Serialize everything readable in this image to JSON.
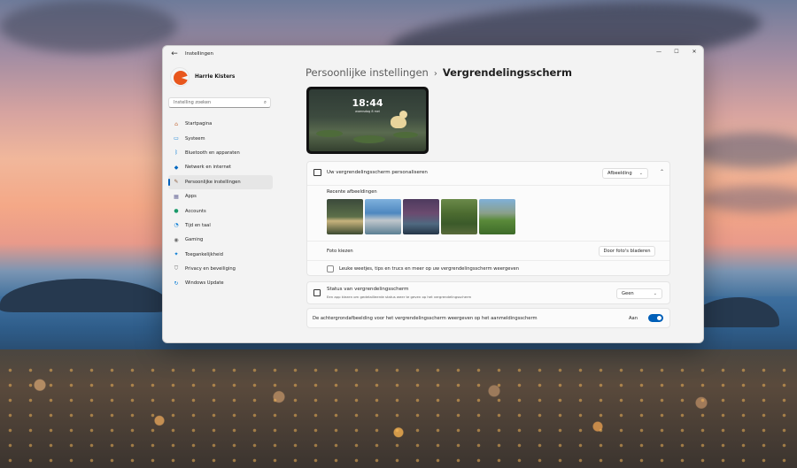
{
  "window": {
    "app_title": "Instellingen",
    "back_glyph": "←",
    "minimize_glyph": "—",
    "maximize_glyph": "☐",
    "close_glyph": "✕"
  },
  "profile": {
    "name": "Harrie Kisters"
  },
  "search": {
    "placeholder": "Instelling zoeken",
    "icon_glyph": "⌕"
  },
  "sidebar": {
    "items": [
      {
        "label": "Startpagina",
        "icon": "home-icon",
        "glyph": "⌂",
        "color": "#c46a3a",
        "active": false
      },
      {
        "label": "Systeem",
        "icon": "system-icon",
        "glyph": "▭",
        "color": "#0078d4",
        "active": false
      },
      {
        "label": "Bluetooth en apparaten",
        "icon": "bluetooth-icon",
        "glyph": "ᛒ",
        "color": "#0078d4",
        "active": false
      },
      {
        "label": "Netwerk en internet",
        "icon": "network-icon",
        "glyph": "◆",
        "color": "#0067c0",
        "active": false
      },
      {
        "label": "Persoonlijke instellingen",
        "icon": "personalization-icon",
        "glyph": "✎",
        "color": "#8a5a3a",
        "active": true
      },
      {
        "label": "Apps",
        "icon": "apps-icon",
        "glyph": "▦",
        "color": "#6b6b9a",
        "active": false
      },
      {
        "label": "Accounts",
        "icon": "accounts-icon",
        "glyph": "●",
        "color": "#1a9a6a",
        "active": false
      },
      {
        "label": "Tijd en taal",
        "icon": "time-language-icon",
        "glyph": "◔",
        "color": "#0078d4",
        "active": false
      },
      {
        "label": "Gaming",
        "icon": "gaming-icon",
        "glyph": "◉",
        "color": "#6b6b6b",
        "active": false
      },
      {
        "label": "Toegankelijkheid",
        "icon": "accessibility-icon",
        "glyph": "✦",
        "color": "#0078d4",
        "active": false
      },
      {
        "label": "Privacy en beveiliging",
        "icon": "shield-icon",
        "glyph": "⛉",
        "color": "#6b6b6b",
        "active": false
      },
      {
        "label": "Windows Update",
        "icon": "windows-update-icon",
        "glyph": "↻",
        "color": "#0078d4",
        "active": false
      }
    ]
  },
  "breadcrumb": {
    "parent": "Persoonlijke instellingen",
    "separator": "›",
    "current": "Vergrendelingsscherm"
  },
  "preview": {
    "time": "18:44",
    "date": "woensdag 8 mei"
  },
  "personalize": {
    "title": "Uw vergrendelingsscherm personaliseren",
    "dropdown_value": "Afbeelding",
    "dropdown_chevron": "⌄",
    "expand_chevron": "⌃",
    "recent_label": "Recente afbeeldingen",
    "thumbnails": [
      "duck-thumbnail",
      "coast-thumbnail",
      "mountain-thumbnail",
      "forest-thumbnail",
      "valley-thumbnail"
    ],
    "choose_photo_label": "Foto kiezen",
    "browse_button": "Door foto's bladeren",
    "tips_label": "Leuke weetjes, tips en trucs en meer op uw vergrendelingsscherm weergeven",
    "tips_checked": false
  },
  "status": {
    "title": "Status van vergrendelingsscherm",
    "subtitle": "Een app kiezen om gedetailleerde status weer te geven op het vergrendelingsscherm",
    "dropdown_value": "Geen",
    "dropdown_chevron": "⌄"
  },
  "background_signin": {
    "label": "De achtergrondafbeelding voor het vergrendelingsscherm weergeven op het aanmeldingsscherm",
    "toggle_label": "Aan",
    "toggle_on": true,
    "accent_color": "#005fb8"
  }
}
